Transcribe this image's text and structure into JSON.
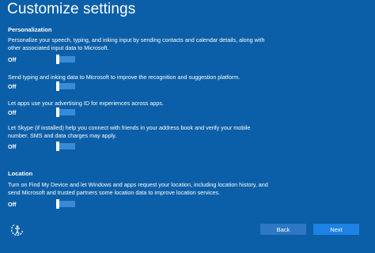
{
  "page": {
    "title": "Customize settings"
  },
  "sections": [
    {
      "heading": "Personalization",
      "settings": [
        {
          "text": "Personalize your speech, typing, and inking input by sending contacts and calendar details, along with other associated input data to Microsoft.",
          "state": "Off"
        },
        {
          "text": "Send typing and inking data to Microsoft to improve the recognition and suggestion platform.",
          "state": "Off"
        },
        {
          "text": "Let apps use your advertising ID for experiences across apps.",
          "state": "Off"
        },
        {
          "text": "Let Skype (if installed) help you connect with friends in your address book and verify your mobile number. SMS and data charges may apply.",
          "state": "Off"
        }
      ]
    },
    {
      "heading": "Location",
      "settings": [
        {
          "text": "Turn on Find My Device and let Windows and apps request your location, including location history, and send Microsoft and trusted partners some location data to improve location services.",
          "state": "Off"
        }
      ]
    }
  ],
  "footer": {
    "ease_of_access_icon": "ease-of-access-icon",
    "back_label": "Back",
    "next_label": "Next"
  },
  "colors": {
    "background": "#0b5fa8",
    "toggle_track": "#3a8ad8",
    "back_button": "#2d77c4",
    "next_button": "#1d83e5"
  }
}
